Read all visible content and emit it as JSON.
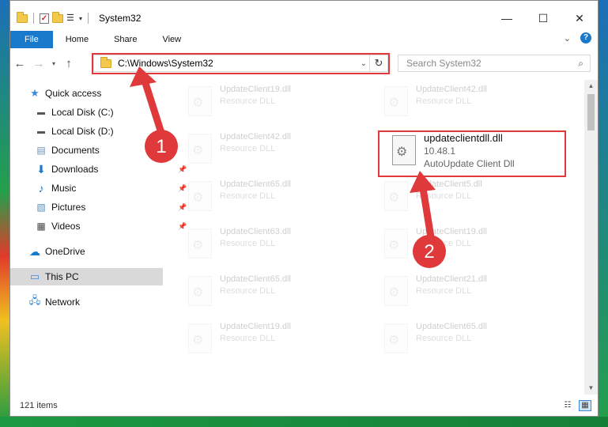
{
  "window": {
    "title": "System32"
  },
  "ribbon": {
    "tabs": [
      "File",
      "Home",
      "Share",
      "View"
    ]
  },
  "address": {
    "path": "C:\\Windows\\System32"
  },
  "search": {
    "placeholder": "Search System32"
  },
  "navigation": {
    "items": [
      {
        "label": "Quick access",
        "icon": "star-icon"
      },
      {
        "label": "Local Disk (C:)",
        "icon": "drive-icon"
      },
      {
        "label": "Local Disk (D:)",
        "icon": "drive-icon"
      },
      {
        "label": "Documents",
        "icon": "documents-icon"
      },
      {
        "label": "Downloads",
        "icon": "downloads-icon"
      },
      {
        "label": "Music",
        "icon": "music-icon"
      },
      {
        "label": "Pictures",
        "icon": "pictures-icon"
      },
      {
        "label": "Videos",
        "icon": "videos-icon"
      },
      {
        "label": "OneDrive",
        "icon": "cloud-icon"
      },
      {
        "label": "This PC",
        "icon": "computer-icon"
      },
      {
        "label": "Network",
        "icon": "network-icon"
      }
    ]
  },
  "files": {
    "left": [
      {
        "name": "UpdateClient19.dll",
        "desc": "Resource DLL"
      },
      {
        "name": "UpdateClient42.dll",
        "desc": "Resource DLL"
      },
      {
        "name": "UpdateClient65.dll",
        "desc": "Resource DLL"
      },
      {
        "name": "UpdateClient63.dll",
        "desc": "Resource DLL"
      },
      {
        "name": "UpdateClient65.dll",
        "desc": "Resource DLL"
      },
      {
        "name": "UpdateClient19.dll",
        "desc": "Resource DLL"
      }
    ],
    "right": [
      {
        "name": "UpdateClient42.dll",
        "desc": "Resource DLL"
      },
      {
        "name": "updateclientdll.dll",
        "version": "10.48.1",
        "desc": "AutoUpdate Client Dll"
      },
      {
        "name": "UpdateClient5.dll",
        "desc": "Resource DLL"
      },
      {
        "name": "UpdateClient19.dll",
        "desc": "Resource DLL"
      },
      {
        "name": "UpdateClient21.dll",
        "desc": "Resource DLL"
      },
      {
        "name": "UpdateClient65.dll",
        "desc": "Resource DLL"
      }
    ]
  },
  "status": {
    "item_count": "121 items"
  },
  "annotations": {
    "step1": "1",
    "step2": "2",
    "color": "#e0393b"
  }
}
